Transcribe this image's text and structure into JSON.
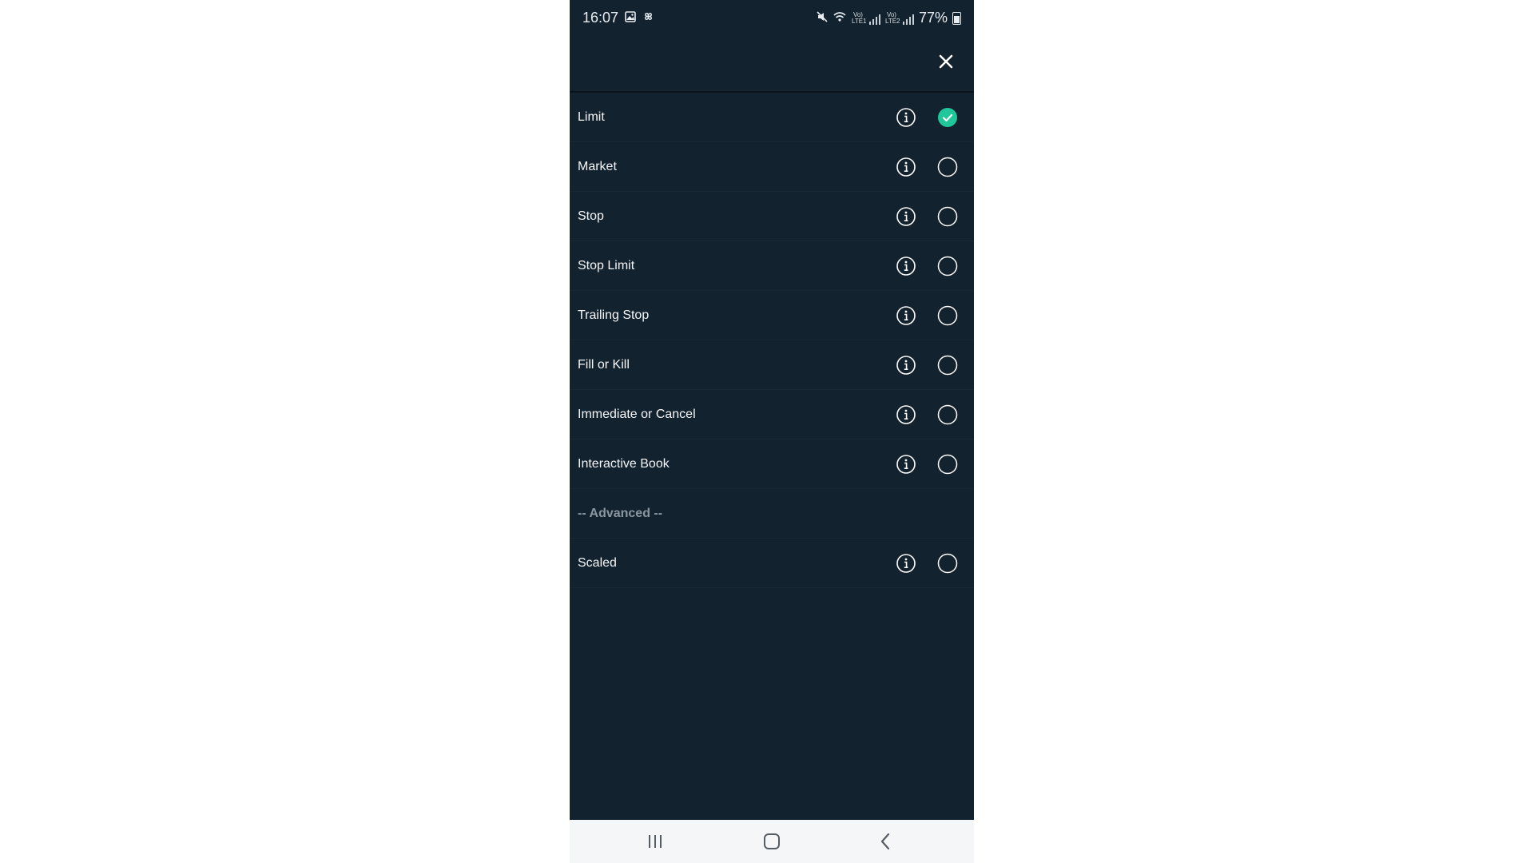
{
  "status_bar": {
    "time": "16:07",
    "battery": "77%",
    "left_icons": [
      "gallery-icon",
      "pinwheel-icon"
    ],
    "right_icons": [
      "mute-icon",
      "wifi-icon",
      "volte-lte1-icon",
      "signal-icon",
      "volte-lte2-icon",
      "signal-icon",
      "battery-icon"
    ],
    "sim1_label": "Vo) LTE1",
    "sim2_label": "Vo) LTE2"
  },
  "header": {
    "close_icon": "close-icon"
  },
  "order_types": [
    {
      "label": "Limit",
      "selected": true
    },
    {
      "label": "Market",
      "selected": false
    },
    {
      "label": "Stop",
      "selected": false
    },
    {
      "label": "Stop Limit",
      "selected": false
    },
    {
      "label": "Trailing Stop",
      "selected": false
    },
    {
      "label": "Fill or Kill",
      "selected": false
    },
    {
      "label": "Immediate or Cancel",
      "selected": false
    },
    {
      "label": "Interactive Book",
      "selected": false
    }
  ],
  "advanced_section": {
    "label": "-- Advanced --"
  },
  "advanced_types": [
    {
      "label": "Scaled",
      "selected": false
    }
  ],
  "nav_bar": {
    "icons": [
      "recents-icon",
      "home-icon",
      "back-icon"
    ]
  },
  "colors": {
    "background": "#13222f",
    "selected_accent": "#1fc79a",
    "section_text": "#8a96a0"
  }
}
